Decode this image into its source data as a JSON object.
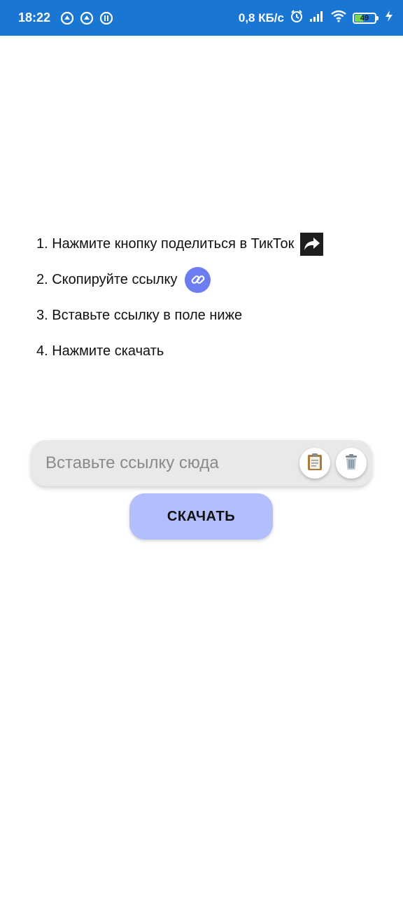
{
  "status_bar": {
    "time": "18:22",
    "network_speed": "0,8 КБ/с",
    "battery_level": "49",
    "battery_percent": 49,
    "icons": [
      "app-notification-icon",
      "app-notification-icon",
      "app-notification-icon",
      "alarm-icon",
      "signal-icon",
      "wifi-icon",
      "battery-icon",
      "charging-icon"
    ]
  },
  "instructions": {
    "step1": "1. Нажмите кнопку поделиться в ТикТок",
    "step2": "2. Скопируйте ссылку",
    "step3": "3. Вставьте ссылку в поле ниже",
    "step4": "4. Нажмите скачать",
    "step1_icon": "share-arrow-icon",
    "step2_icon": "link-icon"
  },
  "link_input": {
    "value": "",
    "placeholder": "Вставьте ссылку сюда",
    "paste_icon": "clipboard-icon",
    "clear_icon": "trash-icon"
  },
  "download_button": {
    "label": "СКАЧАТЬ"
  },
  "colors": {
    "status_bar": "#1976d2",
    "link_icon_bg": "#6b7df0",
    "download_button_bg": "#b3befc",
    "input_bg": "#e9e9e9"
  }
}
